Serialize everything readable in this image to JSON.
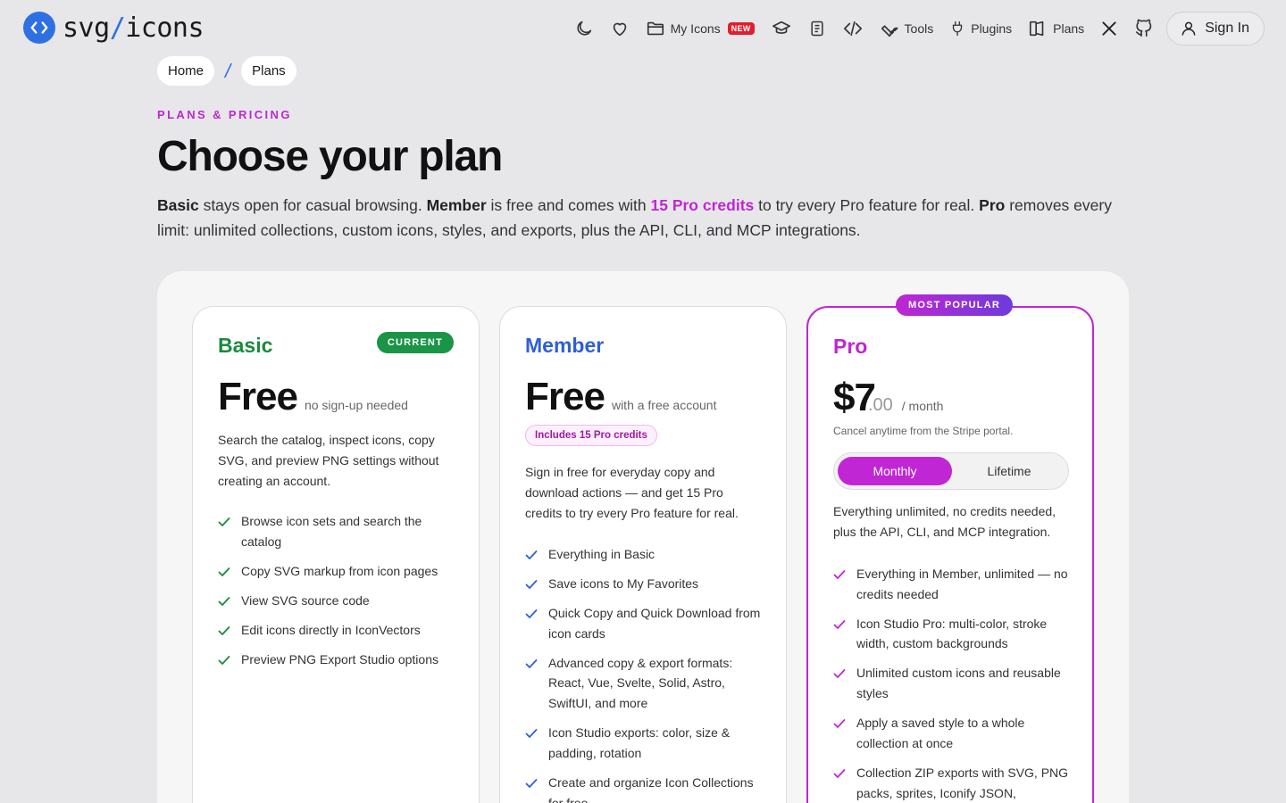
{
  "header": {
    "logo_svg": "svg",
    "logo_slash": "/",
    "logo_icons": "icons",
    "nav": {
      "my_icons": "My Icons",
      "new_badge": "NEW",
      "tools": "Tools",
      "plugins": "Plugins",
      "plans": "Plans",
      "sign_in": "Sign In"
    }
  },
  "breadcrumb": {
    "home": "Home",
    "separator": "/",
    "current": "Plans"
  },
  "hero": {
    "eyebrow": "PLANS & PRICING",
    "title": "Choose your plan",
    "intro": {
      "basic": "Basic",
      "t1": " stays open for casual browsing. ",
      "member": "Member",
      "t2": " is free and comes with ",
      "credits": "15 Pro credits",
      "t3": " to try every Pro feature for real. ",
      "pro": "Pro",
      "t4": " removes every limit: unlimited collections, custom icons, styles, and exports, plus the API, CLI, and MCP integrations."
    }
  },
  "plans": {
    "basic": {
      "name": "Basic",
      "badge": "CURRENT",
      "price": "Free",
      "price_note": "no sign-up needed",
      "description": "Search the catalog, inspect icons, copy SVG, and preview PNG settings without creating an account.",
      "features": [
        "Browse icon sets and search the catalog",
        "Copy SVG markup from icon pages",
        "View SVG source code",
        "Edit icons directly in IconVectors",
        "Preview PNG Export Studio options"
      ]
    },
    "member": {
      "name": "Member",
      "price": "Free",
      "price_note": "with a free account",
      "credits_pill": "Includes 15 Pro credits",
      "description": "Sign in free for everyday copy and download actions — and get 15 Pro credits to try every Pro feature for real.",
      "features": [
        "Everything in Basic",
        "Save icons to My Favorites",
        "Quick Copy and Quick Download from icon cards",
        "Advanced copy & export formats: React, Vue, Svelte, Solid, Astro, SwiftUI, and more",
        "Icon Studio exports: color, size & padding, rotation",
        "Create and organize Icon Collections for free"
      ]
    },
    "pro": {
      "name": "Pro",
      "badge": "MOST POPULAR",
      "price": "$7",
      "price_cents": ".00",
      "price_note": "/ month",
      "cancel_note": "Cancel anytime from the Stripe portal.",
      "toggle": {
        "monthly": "Monthly",
        "lifetime": "Lifetime"
      },
      "description": "Everything unlimited, no credits needed, plus the API, CLI, and MCP integration.",
      "features": [
        "Everything in Member, unlimited — no credits needed",
        "Icon Studio Pro: multi-color, stroke width, custom backgrounds",
        "Unlimited custom icons and reusable styles",
        "Apply a saved style to a whole collection at once",
        "Collection ZIP exports with SVG, PNG packs, sprites, Iconify JSON,"
      ]
    }
  },
  "colors": {
    "brand": "#2f6fe4",
    "accent": "#c026d3",
    "basic": "#1a8a3c",
    "member": "#2f5fd6"
  }
}
